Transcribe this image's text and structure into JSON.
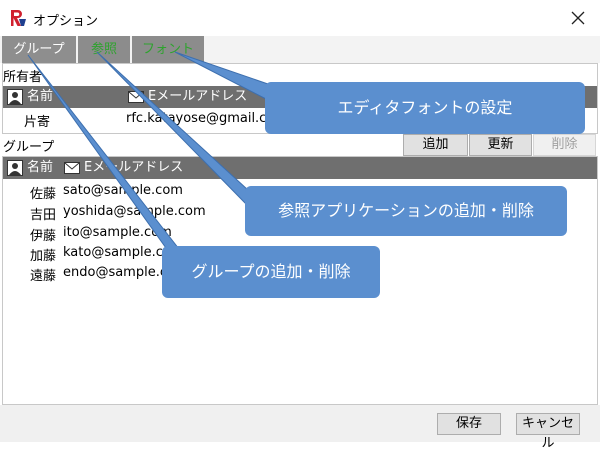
{
  "window": {
    "title": "オプション"
  },
  "tabs": [
    {
      "label": "グループ"
    },
    {
      "label": "参照"
    },
    {
      "label": "フォント"
    }
  ],
  "owner": {
    "section_label": "所有者",
    "columns": [
      "名前",
      "Eメールアドレス"
    ],
    "rows": [
      {
        "name": "片寄",
        "email": "rfc.katayose@gmail.com"
      }
    ]
  },
  "group": {
    "section_label": "グループ",
    "buttons": {
      "add": "追加",
      "update": "更新",
      "delete": "削除"
    },
    "columns": [
      "名前",
      "Eメールアドレス"
    ],
    "rows": [
      {
        "name": "佐藤",
        "email": "sato@sample.com"
      },
      {
        "name": "吉田",
        "email": "yoshida@sample.com"
      },
      {
        "name": "伊藤",
        "email": "ito@sample.com"
      },
      {
        "name": "加藤",
        "email": "kato@sample.com"
      },
      {
        "name": "遠藤",
        "email": "endo@sample.com"
      }
    ]
  },
  "footer": {
    "save": "保存",
    "cancel": "キャンセル"
  },
  "callouts": {
    "font": "エディタフォントの設定",
    "reference": "参照アプリケーションの追加・削除",
    "group": "グループの追加・削除"
  },
  "colors": {
    "callout": "#5b8fcf",
    "header": "#6f6f6f",
    "tab": "#8e8e8e",
    "tab_active_text": "#2ea32e",
    "app_icon": "#d0202e"
  }
}
